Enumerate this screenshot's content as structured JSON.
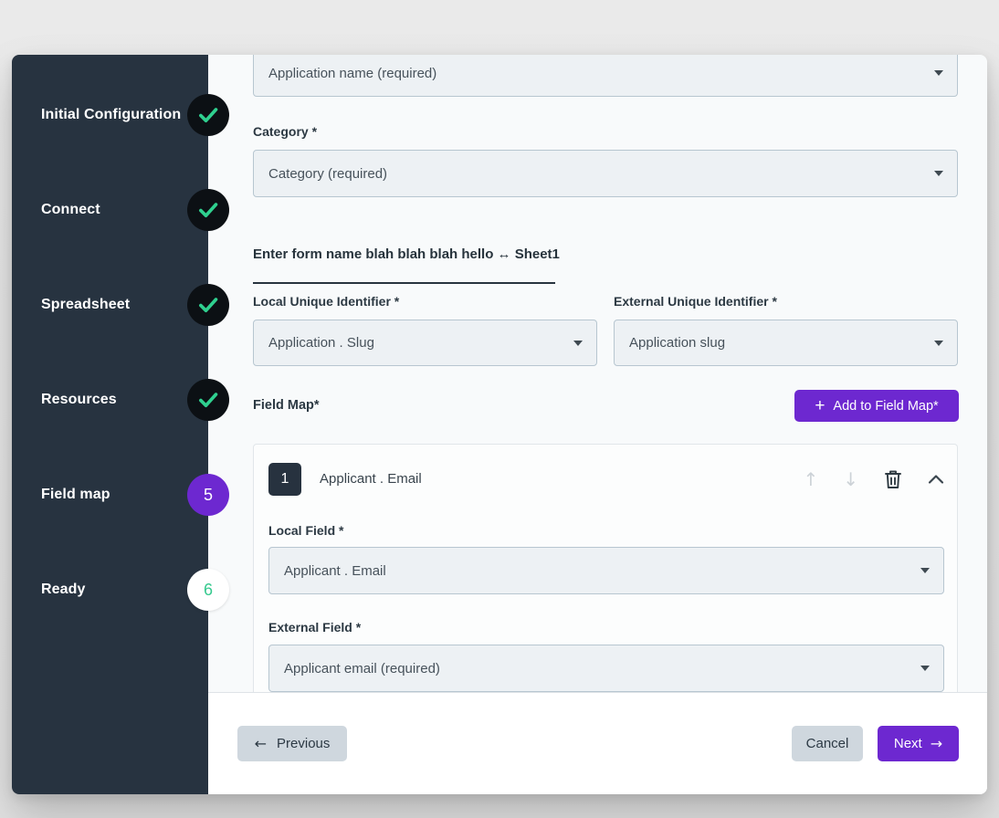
{
  "sidebar": {
    "steps": [
      {
        "label": "Initial Configuration",
        "state": "done"
      },
      {
        "label": "Connect",
        "state": "done"
      },
      {
        "label": "Spreadsheet",
        "state": "done"
      },
      {
        "label": "Resources",
        "state": "done"
      },
      {
        "label": "Field map",
        "state": "current",
        "number": "5"
      },
      {
        "label": "Ready",
        "state": "upcoming",
        "number": "6"
      }
    ]
  },
  "main": {
    "application_name_value": "Application name (required)",
    "category_label": "Category *",
    "category_value": "Category (required)",
    "form_name_value": "Enter form name blah blah blah hello ↔ Sheet1",
    "local_uid_label": "Local Unique Identifier *",
    "local_uid_value": "Application . Slug",
    "external_uid_label": "External Unique Identifier *",
    "external_uid_value": "Application slug",
    "field_map_label": "Field Map*",
    "add_field_map_label": "Add to Field Map*",
    "field_map_items": [
      {
        "index": "1",
        "title": "Applicant . Email",
        "local_field_label": "Local Field *",
        "local_field_value": "Applicant . Email",
        "external_field_label": "External Field *",
        "external_field_value": "Applicant email (required)"
      }
    ]
  },
  "footer": {
    "previous": "Previous",
    "cancel": "Cancel",
    "next": "Next"
  },
  "icons": {
    "plus": "+",
    "up_arrow": "↑",
    "down_arrow": "↓",
    "left_arrow": "←",
    "right_arrow": "→",
    "caret": "css-triangle",
    "check": "svg-check",
    "trash": "svg-trash",
    "chevron_up": "svg-chevron"
  },
  "colors": {
    "accent": "#6d28d0",
    "success": "#2fd08f",
    "sidebar_bg": "#273340",
    "content_bg": "#f8fafb"
  }
}
